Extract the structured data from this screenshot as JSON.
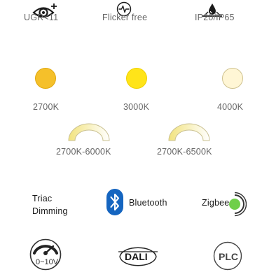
{
  "features": {
    "ugr_label": "UGR<11",
    "flicker_label": "Flicker free",
    "ip_label": "IP20/IP65"
  },
  "color_temps": {
    "items": [
      {
        "label": "2700K",
        "color": "#F5C02A"
      },
      {
        "label": "3000K",
        "color": "#FFE419"
      },
      {
        "label": "4000K",
        "color": "#FFF6D5"
      }
    ],
    "tunable": [
      {
        "label": "2700K-6000K"
      },
      {
        "label": "2700K-6500K"
      }
    ]
  },
  "dimming": {
    "triac_line1": "Triac",
    "triac_line2": "Dimming",
    "bluetooth_label": "Bluetooth",
    "zigbee_label": "Zigbee",
    "zero_ten_label": "0~10V",
    "dali_label": "DALI",
    "plc_label": "PLC"
  },
  "colors": {
    "bluetooth_blue": "#1565C0",
    "zigbee_green": "#6FCF4A",
    "icon_dark": "#1a1a1a"
  }
}
